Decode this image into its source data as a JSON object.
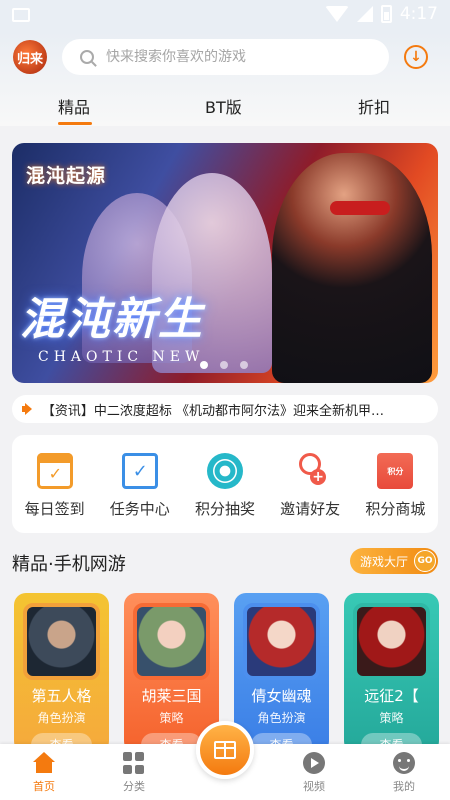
{
  "status_bar": {
    "time": "4:17"
  },
  "header": {
    "logo_text": "归来",
    "search_placeholder": "快来搜索你喜欢的游戏",
    "tabs": [
      {
        "label": "精品"
      },
      {
        "label": "BT版"
      },
      {
        "label": "折扣"
      }
    ],
    "active_tab": "精品"
  },
  "banner": {
    "game_logo": "混沌起源",
    "title": "混沌新生",
    "subtitle": "CHAOTIC NEW",
    "dot_count": 3,
    "active_dot": 0
  },
  "news": {
    "text": "【资讯】中二浓度超标 《机动都市阿尔法》迎来全新机甲…"
  },
  "quick_actions": [
    {
      "label": "每日签到",
      "icon": "calendar-check-icon"
    },
    {
      "label": "任务中心",
      "icon": "task-doc-icon"
    },
    {
      "label": "积分抽奖",
      "icon": "lottery-wheel-icon"
    },
    {
      "label": "邀请好友",
      "icon": "invite-user-icon"
    },
    {
      "label": "积分商城",
      "icon": "points-shop-icon",
      "badge": "积分"
    }
  ],
  "section": {
    "title": "精品·手机网游",
    "hall_button": "游戏大厅",
    "go": "GO"
  },
  "games": [
    {
      "name": "第五人格",
      "genre": "角色扮演",
      "action": "查看",
      "color": "#f4b735"
    },
    {
      "name": "胡莱三国",
      "genre": "策略",
      "action": "查看",
      "color": "#f8753f"
    },
    {
      "name": "倩女幽魂",
      "genre": "角色扮演",
      "action": "查看",
      "color": "#4a8ef0"
    },
    {
      "name": "远征2【",
      "genre": "策略",
      "action": "查看",
      "color": "#2fbaa6"
    }
  ],
  "bottom_nav": [
    {
      "label": "首页",
      "active": true
    },
    {
      "label": "分类",
      "active": false
    },
    {
      "label": "视频",
      "active": false
    },
    {
      "label": "我的",
      "active": false
    }
  ],
  "colors": {
    "accent": "#f47a0f"
  }
}
